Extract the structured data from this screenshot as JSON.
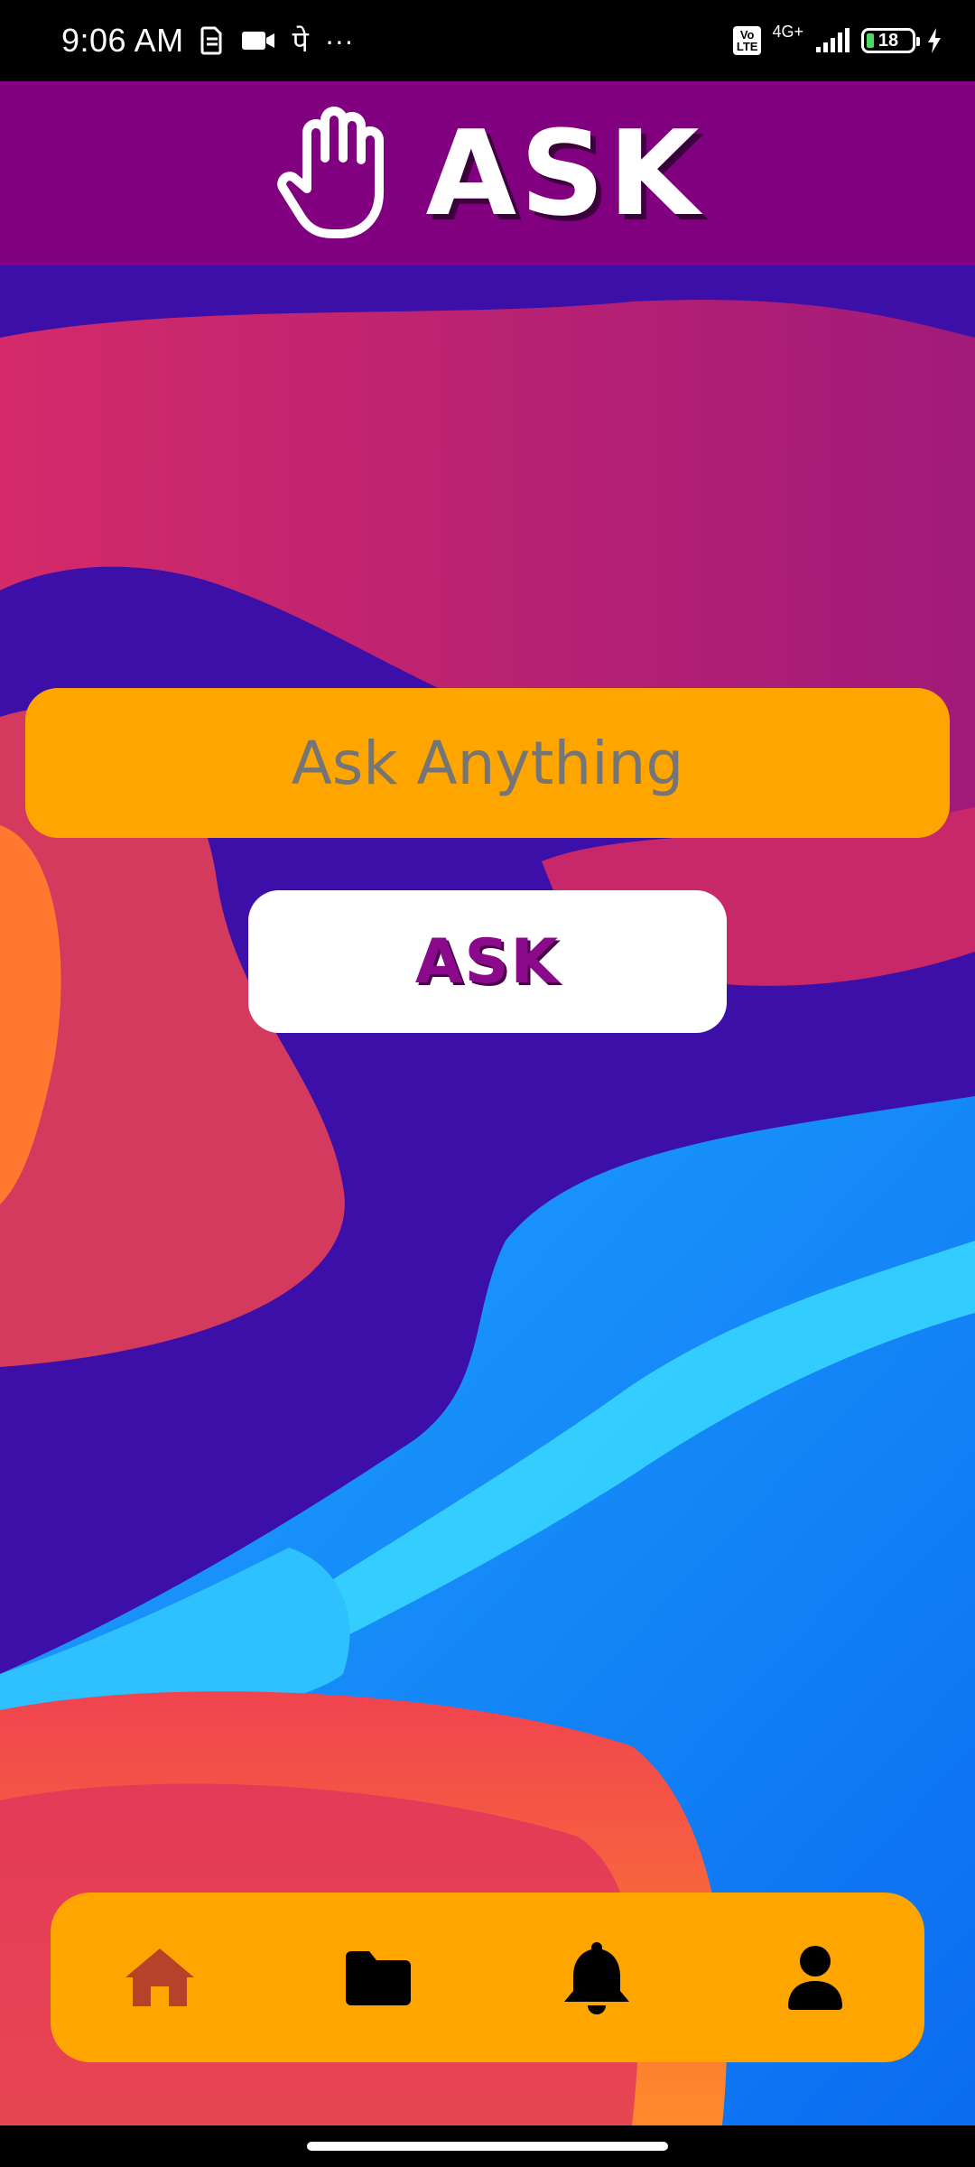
{
  "status_bar": {
    "time": "9:06 AM",
    "hindi_app_glyph": "पे",
    "more": "···",
    "volte_top": "Vo",
    "volte_bottom": "LTE",
    "network": "4G+",
    "battery": "18",
    "icons": [
      "sim-card-icon",
      "video-camera-icon",
      "signal-bars-icon",
      "battery-icon",
      "charging-bolt-icon"
    ]
  },
  "header": {
    "title": "ASK",
    "icon": "raised-hand-icon",
    "background_color": "#800080"
  },
  "main": {
    "input_placeholder": "Ask Anything",
    "input_value": "",
    "ask_button_label": "ASK",
    "input_color": "#FFA500"
  },
  "bottom_nav": {
    "items": [
      {
        "name": "home",
        "icon": "home-icon",
        "active": true,
        "color": "#B5432A"
      },
      {
        "name": "folder",
        "icon": "folder-icon",
        "active": false,
        "color": "#000000"
      },
      {
        "name": "notifications",
        "icon": "bell-icon",
        "active": false,
        "color": "#000000"
      },
      {
        "name": "profile",
        "icon": "user-icon",
        "active": false,
        "color": "#000000"
      }
    ],
    "background_color": "#FFA500"
  }
}
